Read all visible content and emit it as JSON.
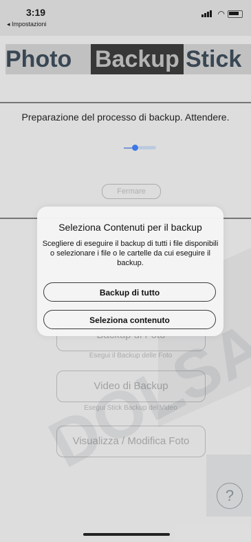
{
  "status_bar": {
    "time": "3:19",
    "back_label": "◂ Impostazioni"
  },
  "header": {
    "word1": "Photo",
    "word2": "Backup",
    "word3": "Stick"
  },
  "progress": {
    "message": "Preparazione del processo di backup. Attendere.",
    "stop_label": "Fermare"
  },
  "menu": {
    "items": [
      {
        "label": "Backup di Foto",
        "caption": "Esegui il Backup delle Foto"
      },
      {
        "label": "Video di Backup",
        "caption": "Esegui Stick Backup del Video"
      },
      {
        "label": "Visualizza / Modifica Foto",
        "caption": ""
      }
    ]
  },
  "help": {
    "label": "?"
  },
  "watermark": {
    "text": "DOLSAM"
  },
  "dialog": {
    "title": "Seleziona Contenuti per il backup",
    "message": "Scegliere di eseguire il backup di tutti i file disponibili o selezionare i file o le cartelle da cui eseguire il backup.",
    "backup_all_label": "Backup di tutto",
    "select_content_label": "Seleziona contenuto"
  },
  "colors": {
    "accent": "#3f7df0",
    "logo_text": "#3c4a57"
  }
}
